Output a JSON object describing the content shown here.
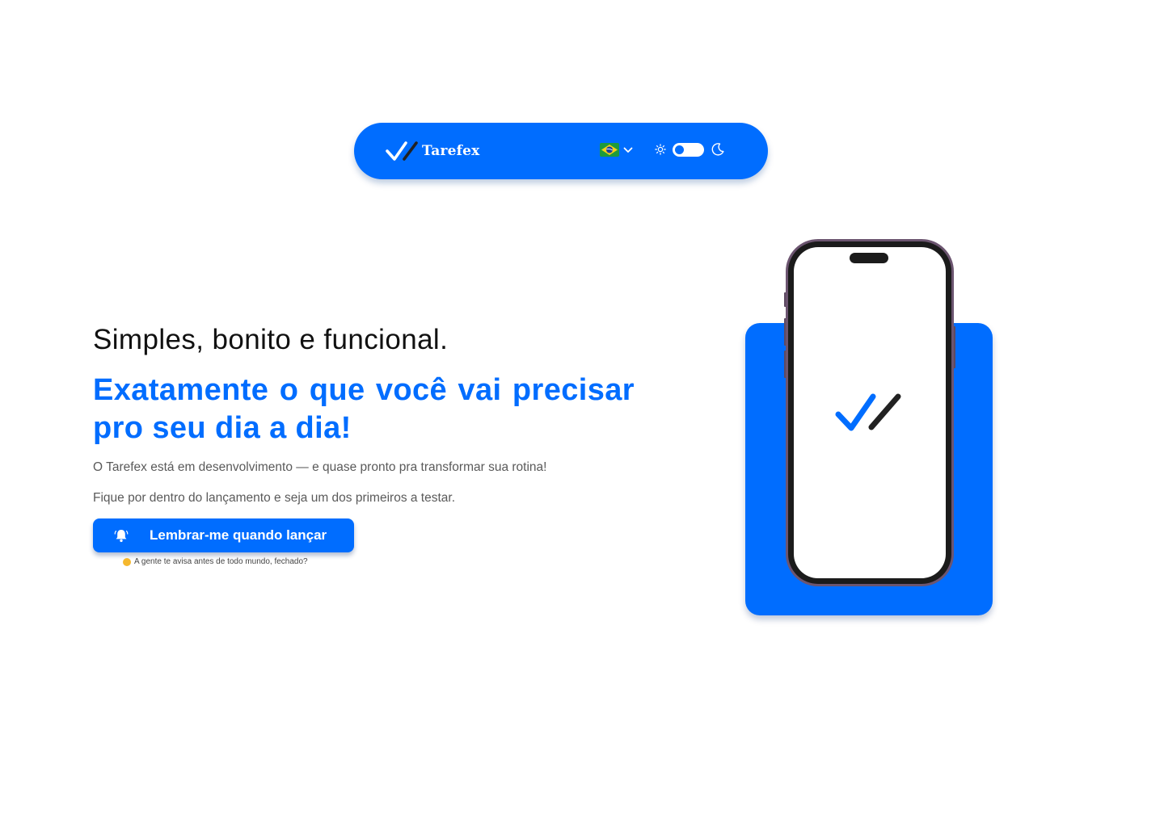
{
  "header": {
    "brand_name": "Tarefex",
    "logo_icon": "double-check-icon",
    "language": {
      "flag": "brazil-flag-icon",
      "chevron": "chevron-down-icon"
    },
    "theme": {
      "light_icon": "sun-icon",
      "dark_icon": "moon-icon",
      "mode": "light"
    }
  },
  "hero": {
    "tagline": "Simples, bonito e funcional.",
    "headline": "Exatamente o que você vai precisar pro seu dia a dia!",
    "description_1": "O Tarefex está em desenvolvimento — e quase pronto pra transformar sua rotina!",
    "description_2": "Fique por dentro do lançamento e seja um dos primeiros a testar.",
    "cta_label": "Lembrar-me quando lançar",
    "cta_icon": "bell-ringing-icon",
    "cta_note": "A gente te avisa antes de todo mundo, fechado?",
    "cta_note_icon": "grinning-face-emoji-icon"
  },
  "illustration": {
    "device": "smartphone",
    "screen_icon": "double-check-icon"
  },
  "colors": {
    "brand_blue": "#006DFF",
    "text_dark": "#111111",
    "text_muted": "#5a5a5a",
    "white": "#ffffff"
  }
}
